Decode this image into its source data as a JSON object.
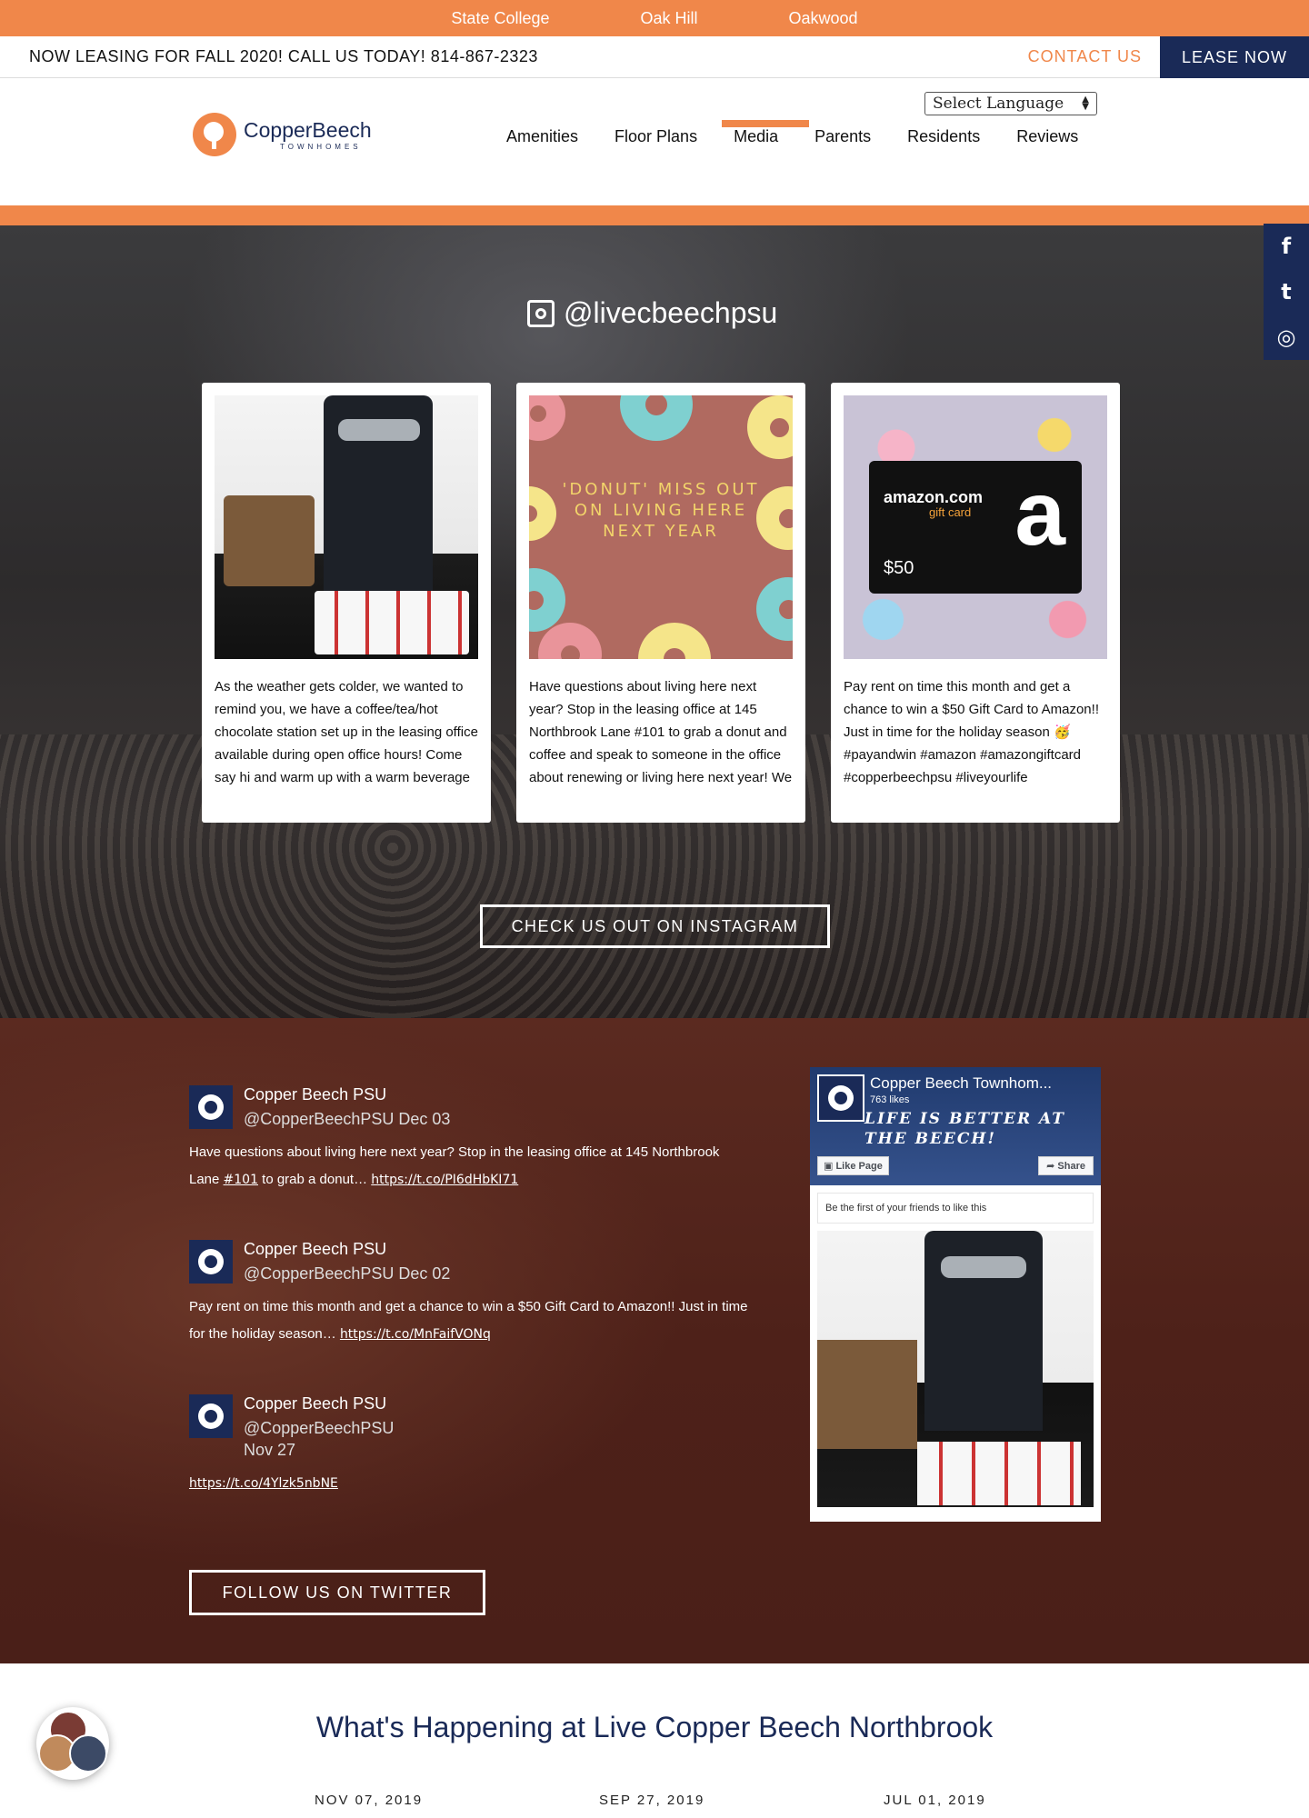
{
  "topbar": {
    "locations": [
      "State College",
      "Oak Hill",
      "Oakwood"
    ]
  },
  "leasebar": {
    "message": "NOW LEASING FOR FALL 2020! CALL US TODAY! 814-867-2323",
    "contact": "CONTACT US",
    "lease": "LEASE NOW"
  },
  "header": {
    "logo_name": "CopperBeech",
    "logo_sub": "TOWNHOMES",
    "language": "Select Language",
    "nav": [
      "Amenities",
      "Floor Plans",
      "Media",
      "Parents",
      "Residents",
      "Reviews"
    ],
    "active_nav": "Media"
  },
  "social": {
    "icons": [
      "facebook-icon",
      "twitter-icon",
      "instagram-icon"
    ],
    "glyphs": [
      "f",
      "t",
      "◎"
    ]
  },
  "instagram": {
    "handle": "@livecbeechpsu",
    "posts": [
      {
        "image": "coffee-station",
        "caption": "As the weather gets colder, we wanted to remind you, we have a coffee/tea/hot chocolate station set up in the leasing office available during open office hours! Come say hi and warm up with a warm beverage ❄️☕😊 #staywarm"
      },
      {
        "image": "donut-graphic",
        "image_text": "'DONUT' MISS OUT ON LIVING HERE NEXT YEAR",
        "caption": "Have questions about living here next year? Stop in the leasing office at 145 Northbrook Lane #101 to grab a donut and coffee and speak to someone in the office about renewing or living here next year! We would love to have you back!"
      },
      {
        "image": "amazon-gift-card",
        "image_text": {
          "brand": "amazon.com",
          "sub": "gift card",
          "amount": "$50",
          "logo": "a"
        },
        "caption": "Pay rent on time this month and get a chance to win a $50 Gift Card to Amazon!! Just in time for the holiday season 🥳 #payandwin #amazon #amazongiftcard #copperbeechpsu #liveyourlife #studentliving"
      }
    ],
    "button": "CHECK US OUT ON INSTAGRAM"
  },
  "twitter": {
    "tweets": [
      {
        "name": "Copper Beech PSU",
        "handle": "@CopperBeechPSU",
        "date": "Dec 03",
        "text": "Have questions about living here next year? Stop in the leasing office at 145 Northbrook Lane ",
        "hashtag": "#101",
        "text2": " to grab a donut… ",
        "link": "https://t.co/PI6dHbKI71"
      },
      {
        "name": "Copper Beech PSU",
        "handle": "@CopperBeechPSU",
        "date": "Dec 02",
        "text": "Pay rent on time this month and get a chance to win a $50 Gift Card to Amazon!! Just in time for the holiday season… ",
        "link": "https://t.co/MnFaifVONq"
      },
      {
        "name": "Copper Beech PSU",
        "handle": "@CopperBeechPSU",
        "date": "Nov 27",
        "link": "https://t.co/4Ylzk5nbNE"
      }
    ],
    "button": "FOLLOW US ON TWITTER"
  },
  "facebook": {
    "title": "Copper Beech Townhom...",
    "likes": "763 likes",
    "slogan": "LIFE IS BETTER AT THE BEECH!",
    "like_button": "Like Page",
    "share_button": "Share",
    "first_friends": "Be the first of your friends to like this"
  },
  "events": {
    "title": "What's Happening at Live Copper Beech Northbrook",
    "dates": [
      "NOV 07, 2019",
      "SEP 27, 2019",
      "JUL 01, 2019"
    ]
  },
  "colors": {
    "orange": "#f0874a",
    "navy": "#1a2a57"
  }
}
